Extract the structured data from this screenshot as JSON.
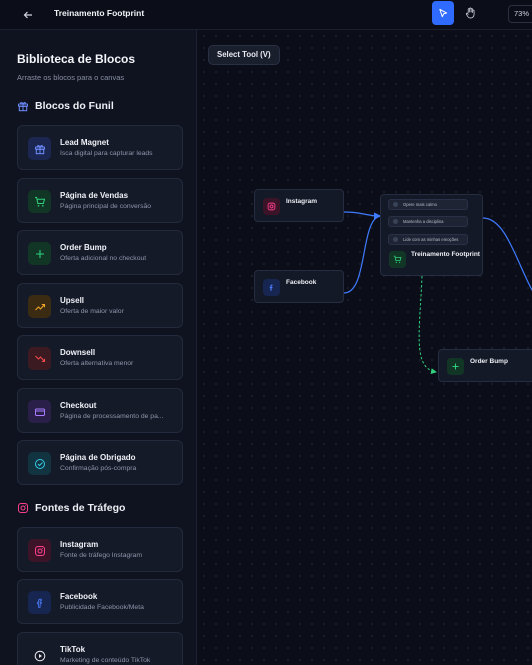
{
  "header": {
    "title": "Treinamento Footprint",
    "zoom": "73%",
    "back_icon": "arrow-left-icon",
    "tools": [
      {
        "name": "select-tool",
        "icon": "cursor-icon",
        "active": true
      },
      {
        "name": "hand-tool",
        "icon": "hand-icon",
        "active": false
      }
    ]
  },
  "sidebar": {
    "title": "Biblioteca de Blocos",
    "subtitle": "Arraste os blocos para o canvas",
    "sections": [
      {
        "label": "Blocos do Funil",
        "icon": "gift-icon",
        "items": [
          {
            "title": "Lead Magnet",
            "desc": "Isca digital para capturar leads",
            "icon": "gift-icon",
            "color": "#6f8dff"
          },
          {
            "title": "Página de Vendas",
            "desc": "Página principal de conversão",
            "icon": "cart-icon",
            "color": "#2fd17c"
          },
          {
            "title": "Order Bump",
            "desc": "Oferta adicional no checkout",
            "icon": "plus-icon",
            "color": "#2fd17c"
          },
          {
            "title": "Upsell",
            "desc": "Oferta de maior valor",
            "icon": "trending-up-icon",
            "color": "#f0a429"
          },
          {
            "title": "Downsell",
            "desc": "Oferta alternativa menor",
            "icon": "trending-down-icon",
            "color": "#f04a4a"
          },
          {
            "title": "Checkout",
            "desc": "Página de processamento de pa...",
            "icon": "credit-card-icon",
            "color": "#a77bff"
          },
          {
            "title": "Página de Obrigado",
            "desc": "Confirmação pós-compra",
            "icon": "check-circle-icon",
            "color": "#35c9e8"
          }
        ]
      },
      {
        "label": "Fontes de Tráfego",
        "icon": "instagram-icon",
        "items": [
          {
            "title": "Instagram",
            "desc": "Fonte de tráfego Instagram",
            "icon": "instagram-icon",
            "color": "#ff3f8e"
          },
          {
            "title": "Facebook",
            "desc": "Publicidade Facebook/Meta",
            "icon": "facebook-icon",
            "color": "#4d7cff"
          },
          {
            "title": "TikTok",
            "desc": "Marketing de conteúdo TikTok",
            "icon": "tiktok-icon",
            "color": "#e8e8e8"
          }
        ]
      }
    ]
  },
  "canvas": {
    "select_tool_label": "Select Tool (V)",
    "nodes": {
      "instagram": {
        "label": "Instagram",
        "icon": "instagram-icon",
        "color": "#ff3f8e"
      },
      "facebook": {
        "label": "Facebook",
        "icon": "facebook-icon",
        "color": "#4d7cff"
      },
      "page": {
        "label": "Treinamento Footprint",
        "icon": "cart-icon",
        "color": "#2fd17c",
        "items": [
          "Opere mais calmo",
          "Mantenha a disciplina",
          "Lide com as minhas emoções"
        ]
      },
      "order_bump": {
        "label": "Order Bump",
        "icon": "plus-icon",
        "color": "#2fd17c"
      }
    },
    "edge_colors": {
      "primary": "#3f7bff",
      "dashed": "#2fd17c"
    }
  }
}
